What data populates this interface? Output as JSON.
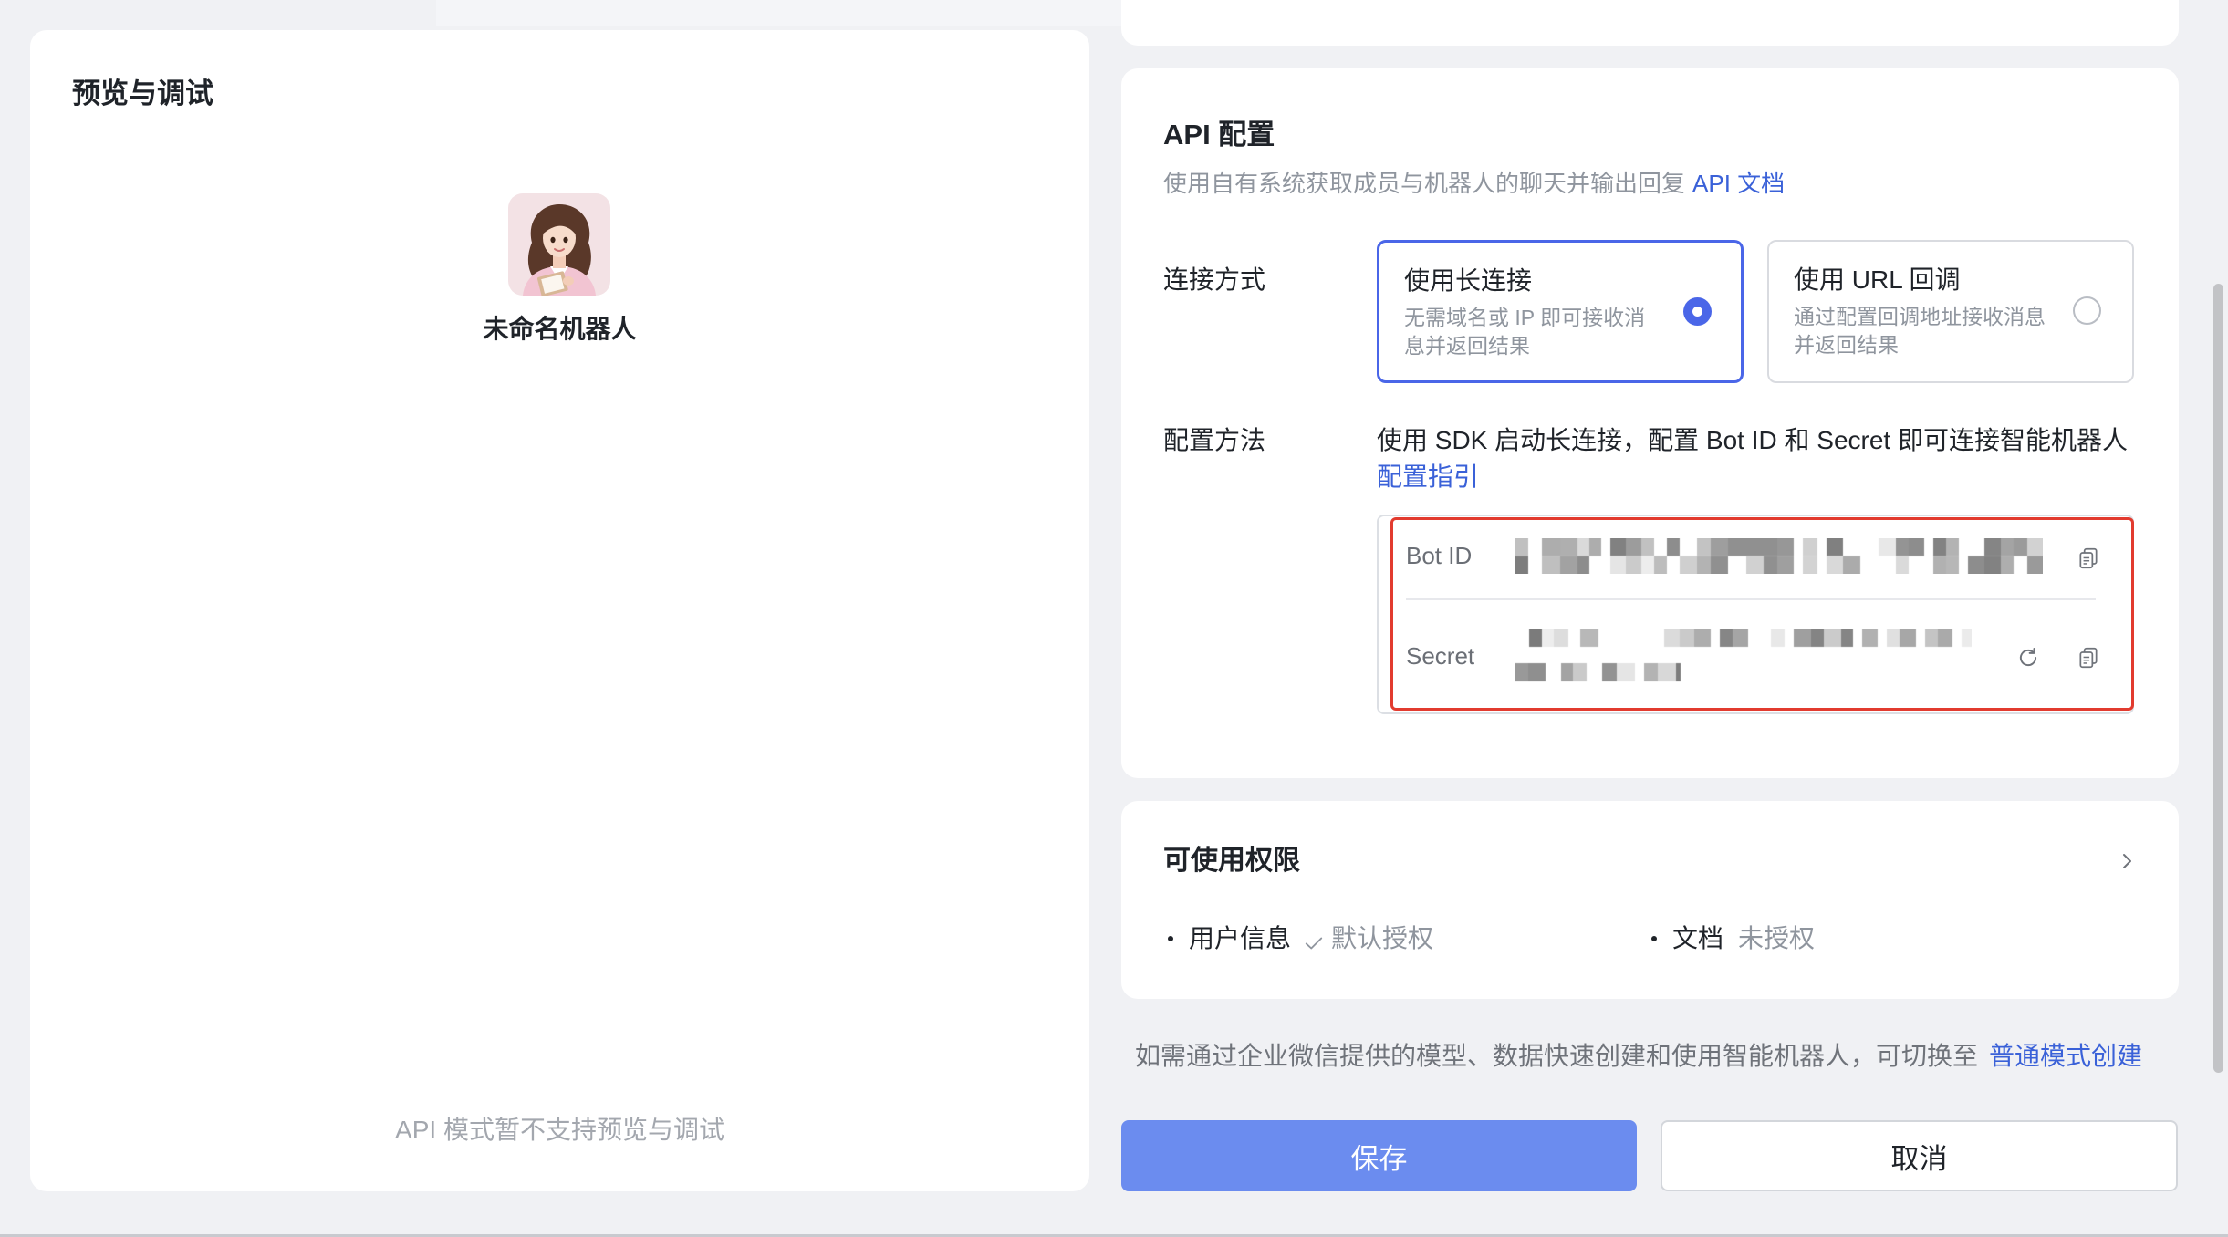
{
  "colors": {
    "accent": "#4a66e8",
    "link": "#3a61d8",
    "primary_button": "#6b8cef",
    "annotation": "#e23b2f",
    "page_background": "#f0f1f4"
  },
  "icons": {
    "copy": "copy-icon",
    "refresh": "refresh-icon",
    "chevron": "chevron-right-icon",
    "check": "check-icon",
    "avatar": "avatar"
  },
  "preview": {
    "title": "预览与调试",
    "bot_name": "未命名机器人",
    "notice": "API 模式暂不支持预览与调试"
  },
  "api_config": {
    "title": "API 配置",
    "description": "使用自有系统获取成员与机器人的聊天并输出回复",
    "doc_link": "API 文档",
    "connection": {
      "label": "连接方式",
      "options": [
        {
          "title": "使用长连接",
          "desc": "无需域名或 IP 即可接收消息并返回结果",
          "selected": true
        },
        {
          "title": "使用 URL 回调",
          "desc": "通过配置回调地址接收消息并返回结果",
          "selected": false
        }
      ]
    },
    "method": {
      "label": "配置方法",
      "text": "使用 SDK 启动长连接，配置 Bot ID 和 Secret 即可连接智能机器人",
      "guide_link": "配置指引"
    },
    "credentials": {
      "bot_id_label": "Bot ID",
      "secret_label": "Secret"
    }
  },
  "permissions": {
    "title": "可使用权限",
    "items": [
      {
        "name": "用户信息",
        "status": "默认授权",
        "granted": true
      },
      {
        "name": "文档",
        "status": "未授权",
        "granted": false
      }
    ]
  },
  "footer": {
    "hint": "如需通过企业微信提供的模型、数据快速创建和使用智能机器人，可切换至",
    "switch_link": "普通模式创建"
  },
  "buttons": {
    "save": "保存",
    "cancel": "取消"
  }
}
